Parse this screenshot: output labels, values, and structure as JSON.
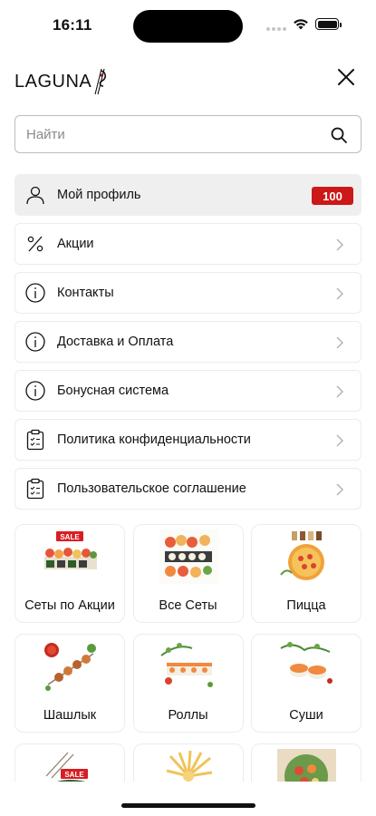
{
  "status": {
    "time": "16:11"
  },
  "header": {
    "logo_text": "LAGUNA"
  },
  "search": {
    "placeholder": "Найти",
    "value": ""
  },
  "menu": {
    "profile": {
      "label": "Мой профиль",
      "badge": "100"
    },
    "items": [
      {
        "label": "Акции",
        "icon": "percent-icon"
      },
      {
        "label": "Контакты",
        "icon": "info-icon"
      },
      {
        "label": "Доставка и Оплата",
        "icon": "info-icon"
      },
      {
        "label": "Бонусная система",
        "icon": "info-icon"
      },
      {
        "label": "Политика конфиденциальности",
        "icon": "clipboard-icon"
      },
      {
        "label": "Пользовательское соглашение",
        "icon": "clipboard-icon"
      }
    ]
  },
  "categories": [
    {
      "label": "Сеты по Акции",
      "badge": "SALE"
    },
    {
      "label": "Все Сеты"
    },
    {
      "label": "Пицца"
    },
    {
      "label": "Шашлык"
    },
    {
      "label": "Роллы"
    },
    {
      "label": "Суши"
    },
    {
      "label": "",
      "badge": "SALE"
    },
    {
      "label": ""
    },
    {
      "label": ""
    }
  ],
  "colors": {
    "accent": "#cc1818",
    "active_bg": "#efefef",
    "border": "#ececec"
  }
}
